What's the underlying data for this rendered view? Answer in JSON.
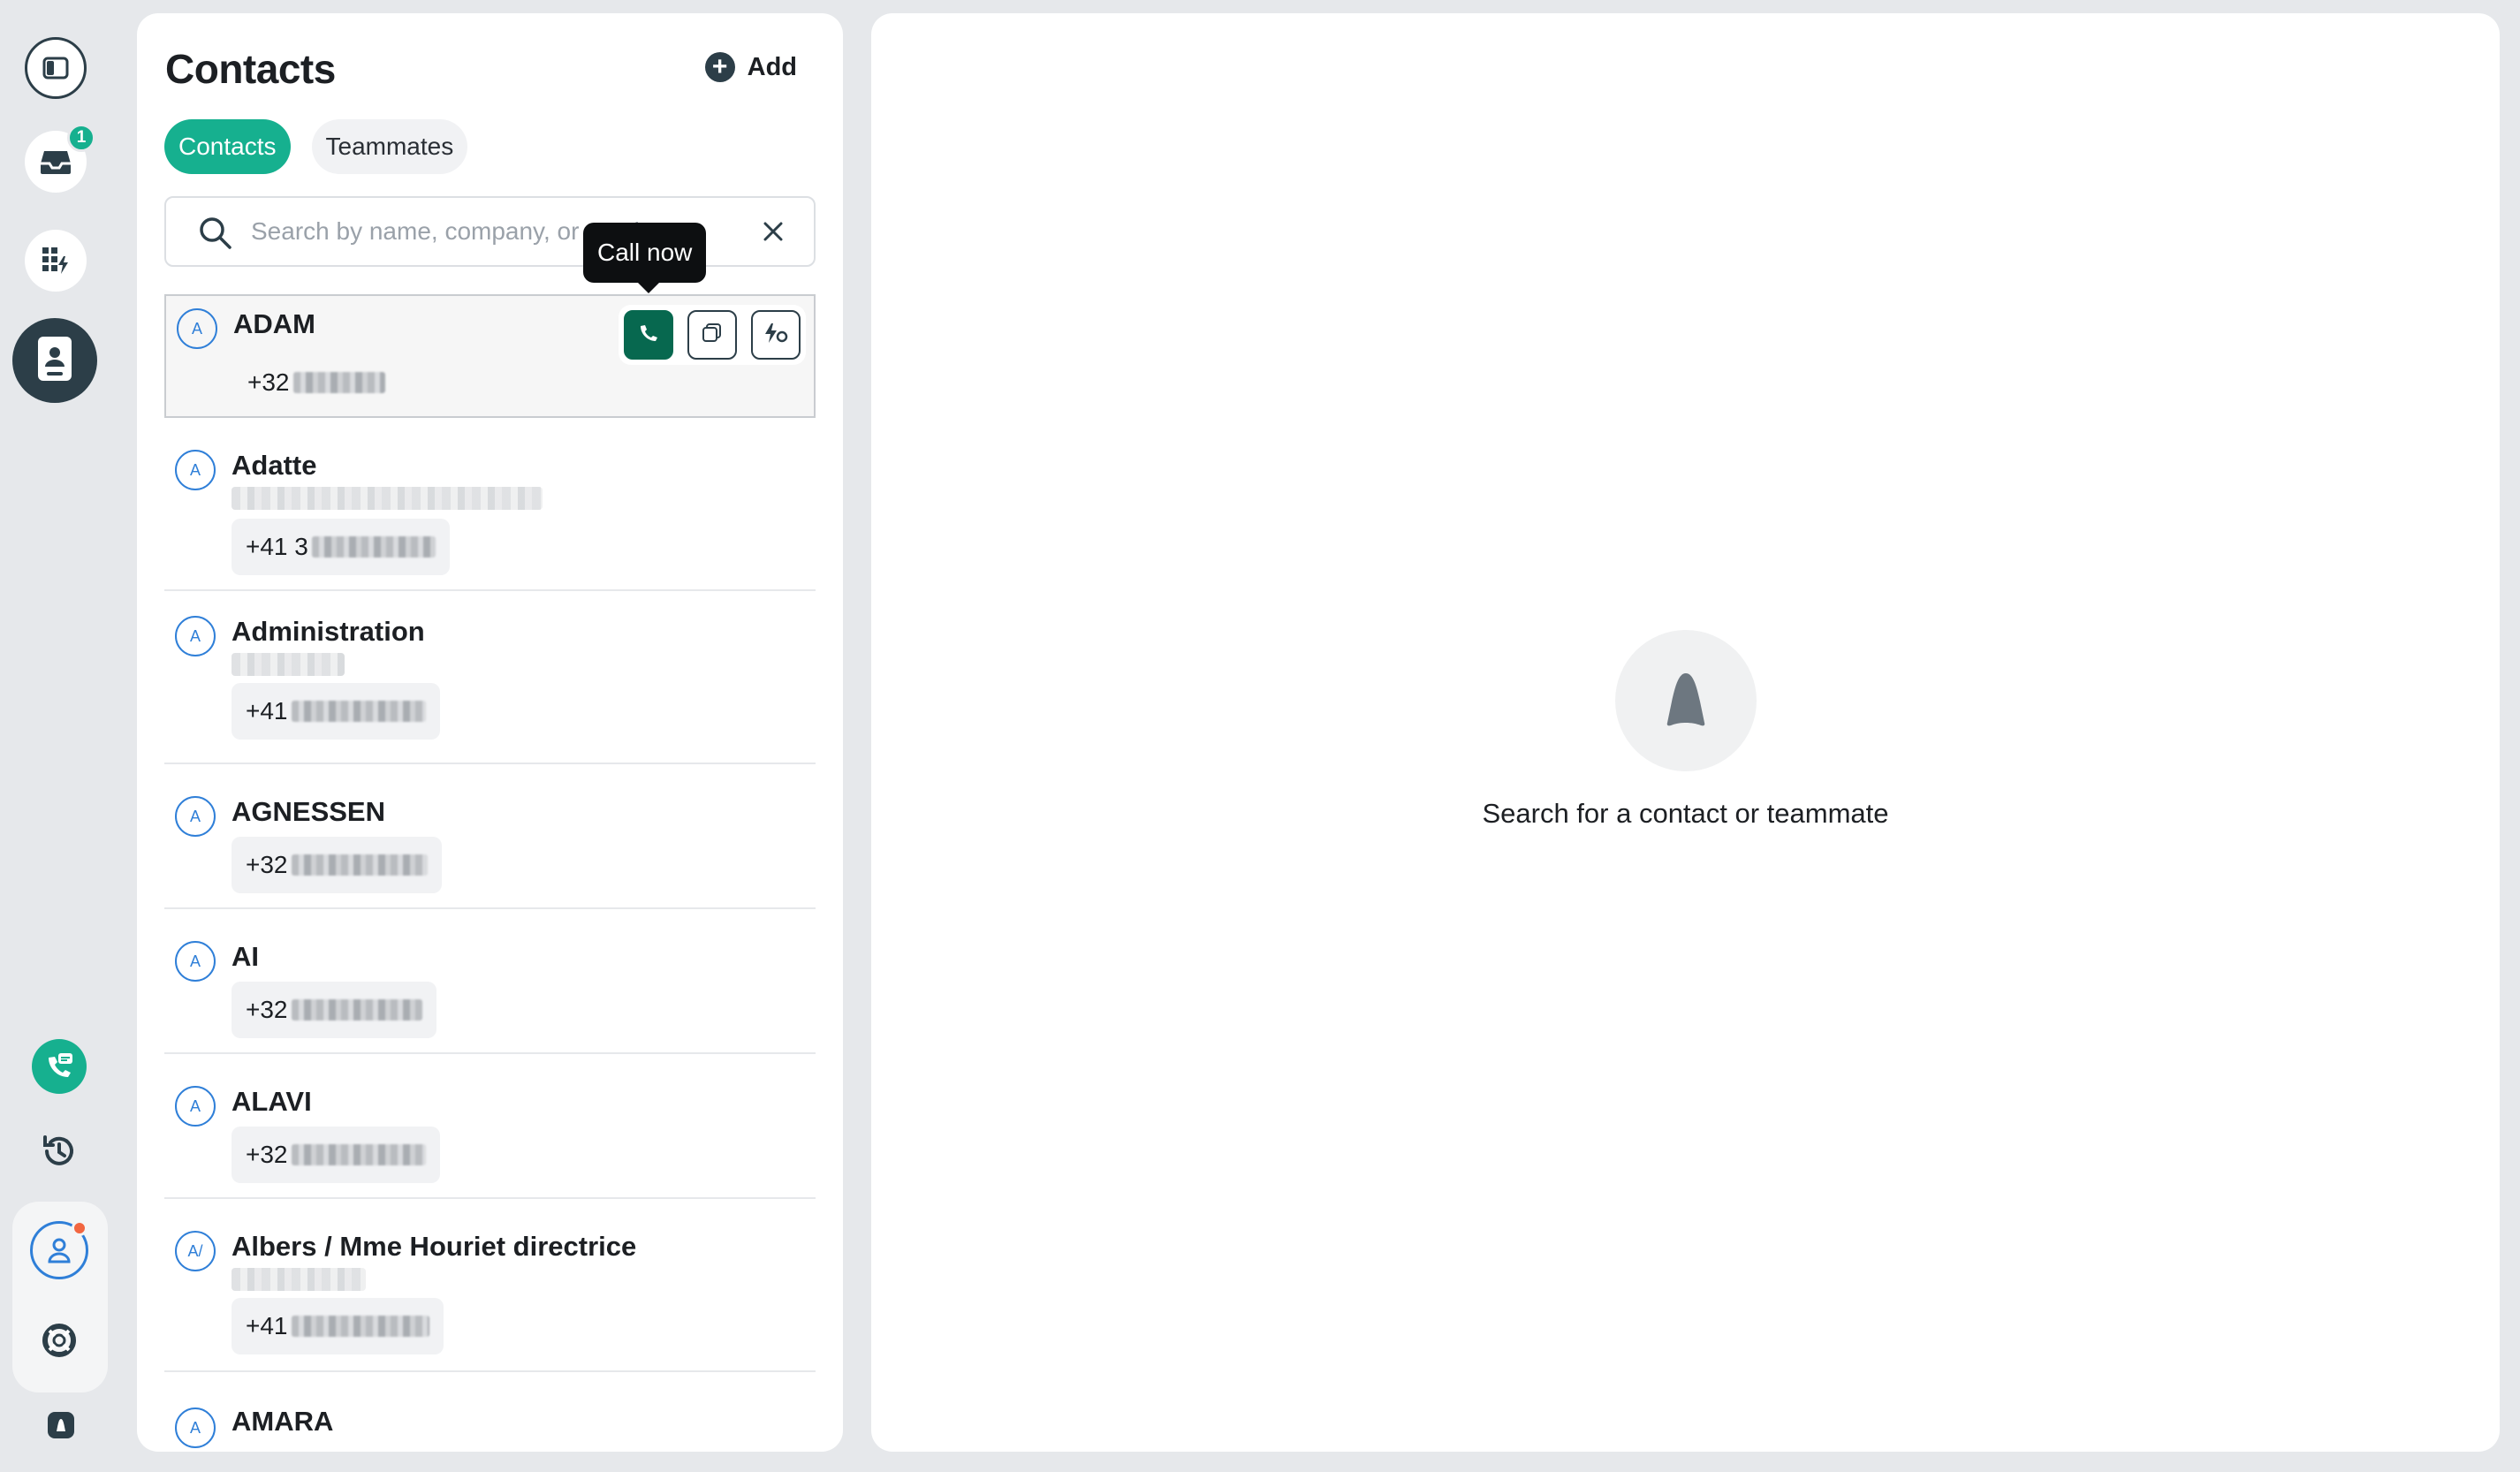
{
  "colors": {
    "brand": "#16b08f",
    "call_button": "#07684f",
    "dark": "#2c3e48",
    "avatar_ring": "#2f7fd8",
    "notification": "#f26640"
  },
  "rail": {
    "toggle_icon": "sidebar-toggle-icon",
    "inbox_icon": "inbox-icon",
    "inbox_badge": "1",
    "apps_icon": "apps-icon",
    "contacts_icon": "contacts-book-icon",
    "dialer_icon": "phone-chat-icon",
    "history_icon": "history-icon",
    "profile_icon": "user-icon",
    "help_icon": "lifebuoy-icon",
    "logo_icon": "aircall-logo-icon"
  },
  "contacts_panel": {
    "title": "Contacts",
    "add_label": "Add",
    "tabs": [
      {
        "label": "Contacts",
        "active": true
      },
      {
        "label": "Teammates",
        "active": false
      }
    ],
    "search": {
      "placeholder": "Search by name, company, or number",
      "value": ""
    },
    "tooltip": "Call now",
    "contacts": [
      {
        "initials": "A",
        "name": "ADAM",
        "phone_prefix": "+32",
        "has_subtitle": false
      },
      {
        "initials": "A",
        "name": "Adatte",
        "phone_prefix": "+41 3",
        "has_subtitle": true
      },
      {
        "initials": "A",
        "name": "Administration",
        "phone_prefix": "+41",
        "has_subtitle": true
      },
      {
        "initials": "A",
        "name": "AGNESSEN",
        "phone_prefix": "+32",
        "has_subtitle": false
      },
      {
        "initials": "A",
        "name": "AI",
        "phone_prefix": "+32",
        "has_subtitle": false
      },
      {
        "initials": "A",
        "name": "ALAVI",
        "phone_prefix": "+32",
        "has_subtitle": false
      },
      {
        "initials": "A/",
        "name": "Albers / Mme Houriet directrice",
        "phone_prefix": "+41",
        "has_subtitle": true
      },
      {
        "initials": "A",
        "name": "AMARA",
        "phone_prefix": "",
        "has_subtitle": false
      }
    ]
  },
  "detail_panel": {
    "empty_message": "Search for a contact or teammate"
  }
}
